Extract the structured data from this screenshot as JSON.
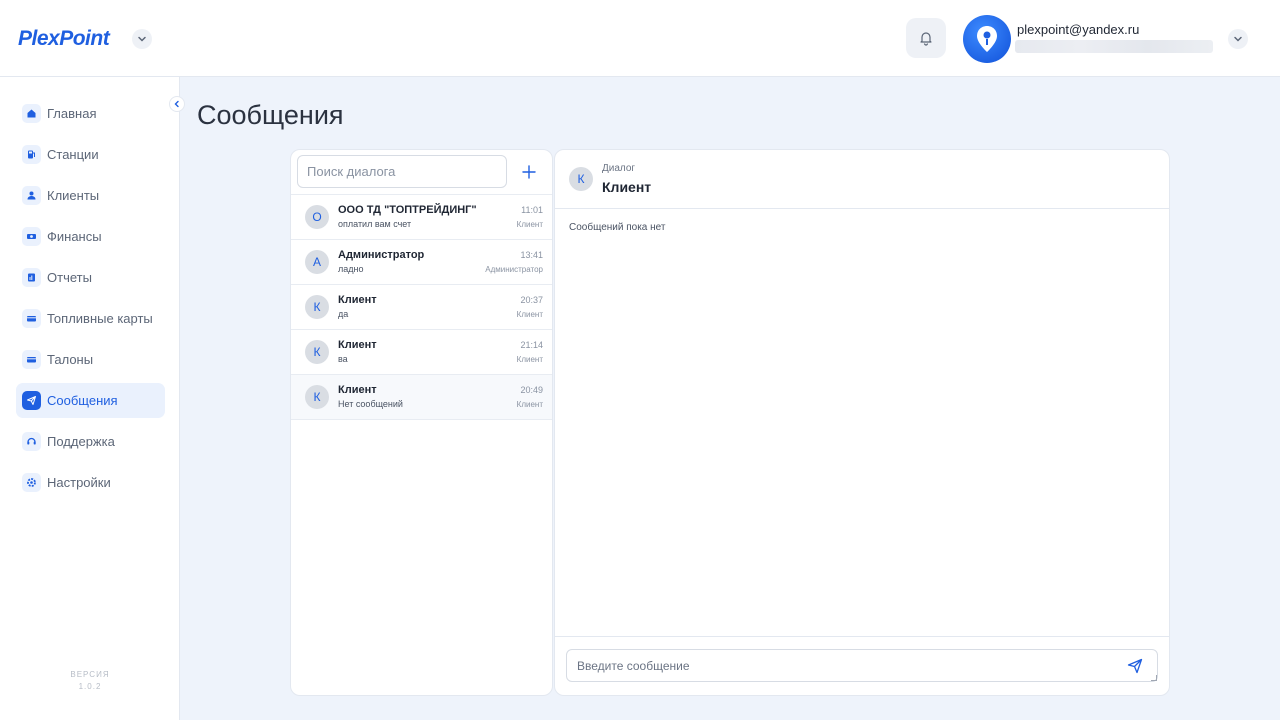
{
  "brand": {
    "logo_text": "PlexPoint"
  },
  "user": {
    "email": "plexpoint@yandex.ru"
  },
  "sidebar": {
    "items": [
      {
        "label": "Главная",
        "icon": "home-icon"
      },
      {
        "label": "Станции",
        "icon": "fuel-station-icon"
      },
      {
        "label": "Клиенты",
        "icon": "users-icon"
      },
      {
        "label": "Финансы",
        "icon": "finance-icon"
      },
      {
        "label": "Отчеты",
        "icon": "reports-icon"
      },
      {
        "label": "Топливные карты",
        "icon": "card-icon"
      },
      {
        "label": "Талоны",
        "icon": "coupon-icon"
      },
      {
        "label": "Сообщения",
        "icon": "send-icon",
        "active": true
      },
      {
        "label": "Поддержка",
        "icon": "support-icon"
      },
      {
        "label": "Настройки",
        "icon": "settings-icon"
      }
    ],
    "version_label": "ВЕРСИЯ",
    "version_value": "1.0.2"
  },
  "page": {
    "title": "Сообщения"
  },
  "dialogs": {
    "search_placeholder": "Поиск диалога",
    "items": [
      {
        "initial": "О",
        "name": "ООО ТД \"ТОПТРЕЙДИНГ\"",
        "message": "оплатил вам счет",
        "time": "11:01",
        "role": "Клиент"
      },
      {
        "initial": "А",
        "name": "Администратор",
        "message": "ладно",
        "time": "13:41",
        "role": "Администратор"
      },
      {
        "initial": "К",
        "name": "Клиент",
        "message": "да",
        "time": "20:37",
        "role": "Клиент"
      },
      {
        "initial": "К",
        "name": "Клиент",
        "message": "ва",
        "time": "21:14",
        "role": "Клиент"
      },
      {
        "initial": "К",
        "name": "Клиент",
        "message": "Нет сообщений",
        "time": "20:49",
        "role": "Клиент",
        "selected": true
      }
    ]
  },
  "chat": {
    "avatar_initial": "К",
    "subtitle": "Диалог",
    "title": "Клиент",
    "empty_text": "Сообщений пока нет",
    "input_placeholder": "Введите сообщение"
  },
  "colors": {
    "accent": "#1f5fe0",
    "page_bg": "#eef3fb"
  }
}
